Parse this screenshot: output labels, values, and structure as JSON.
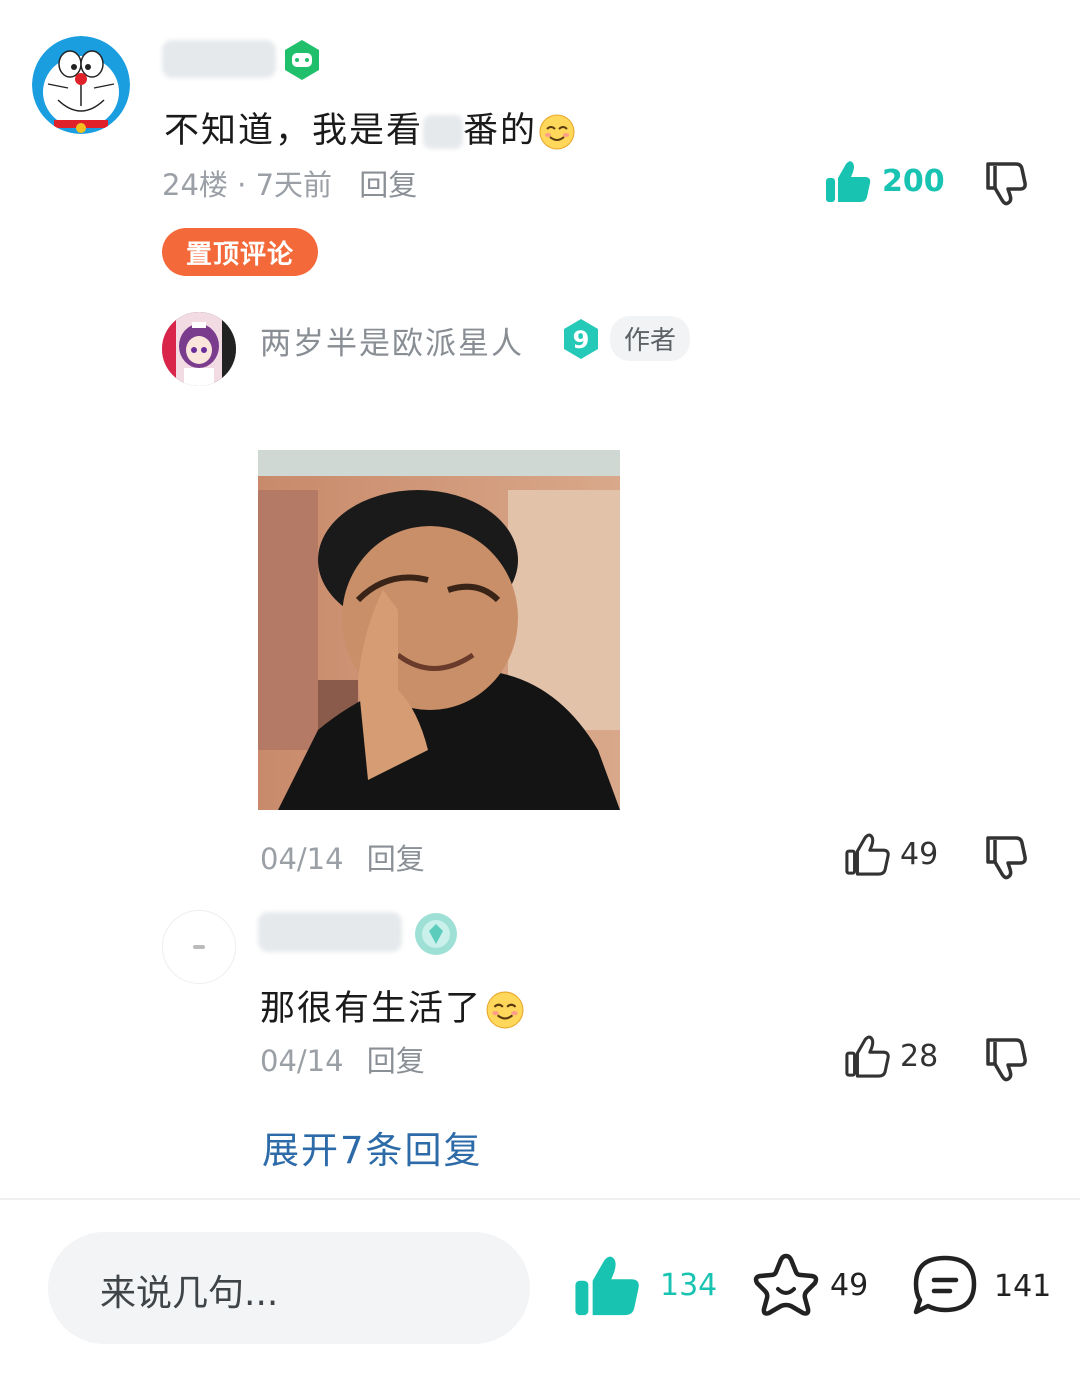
{
  "main_comment": {
    "avatar": "doraemon-avatar",
    "badge_icon": "game-controller-badge-icon",
    "text": "不知道，我是看",
    "text_tail": "番的",
    "emoji": "smug-face-emoji",
    "floor": "24楼",
    "time": "7天前",
    "reply_label": "回复",
    "likes": "200",
    "pinned_label": "置顶评论",
    "like_color": "#19c3b2"
  },
  "replies": [
    {
      "name": "两岁半是欧派星人",
      "level": "9",
      "author_label": "作者",
      "date": "04/14",
      "reply_label": "回复",
      "likes": "49"
    },
    {
      "text": "那很有生活了",
      "date": "04/14",
      "reply_label": "回复",
      "likes": "28"
    }
  ],
  "expand_label": "展开7条回复",
  "bottom_bar": {
    "placeholder": "来说几句...",
    "likes": "134",
    "favorites": "49",
    "comments": "141"
  },
  "colors": {
    "teal": "#19c3b2",
    "orange": "#f4693a",
    "link_blue": "#2c6aa8"
  }
}
